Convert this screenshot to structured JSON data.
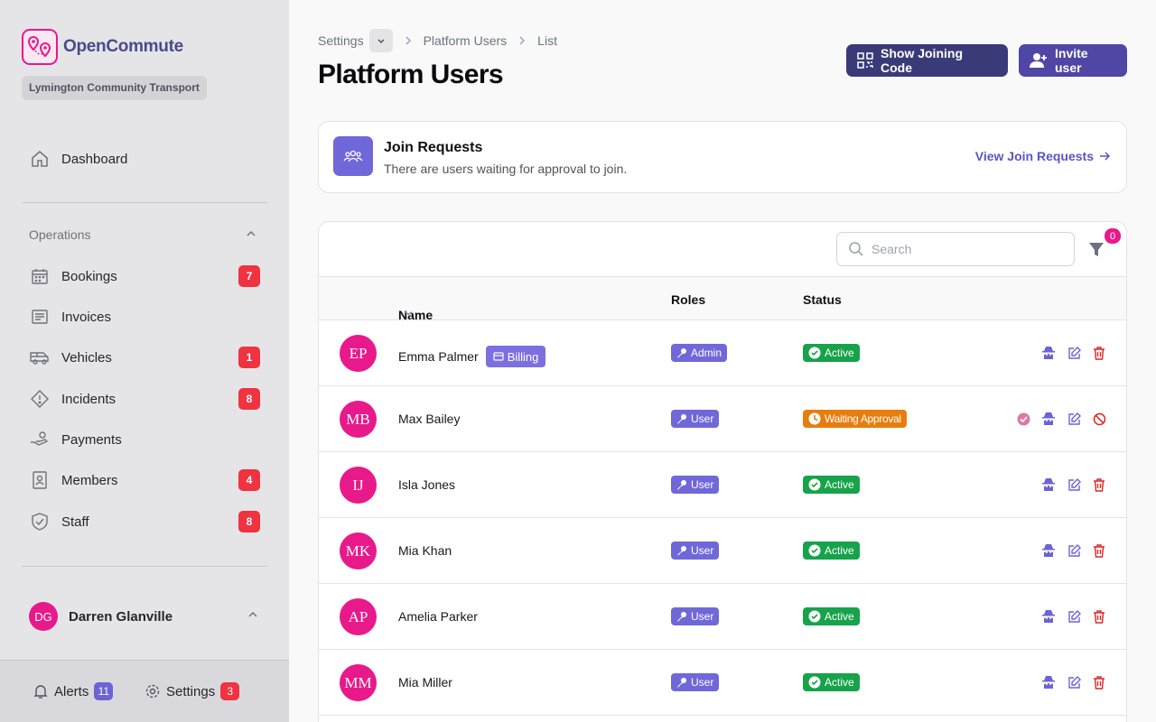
{
  "brand": {
    "name": "OpenCommute",
    "org": "Lymington Community Transport"
  },
  "nav": {
    "dashboard": "Dashboard",
    "section": "Operations",
    "items": [
      {
        "label": "Bookings",
        "count": "7"
      },
      {
        "label": "Invoices",
        "count": ""
      },
      {
        "label": "Vehicles",
        "count": "1"
      },
      {
        "label": "Incidents",
        "count": "8"
      },
      {
        "label": "Payments",
        "count": ""
      },
      {
        "label": "Members",
        "count": "4"
      },
      {
        "label": "Staff",
        "count": "8"
      }
    ]
  },
  "user": {
    "initials": "DG",
    "name": "Darren Glanville"
  },
  "footer": {
    "alerts_label": "Alerts",
    "alerts_count": "11",
    "settings_label": "Settings",
    "settings_count": "3"
  },
  "breadcrumb": {
    "root": "Settings",
    "section": "Platform Users",
    "current": "List"
  },
  "page": {
    "title": "Platform Users"
  },
  "actions": {
    "joining_code": "Show Joining Code",
    "invite": "Invite user"
  },
  "join_requests": {
    "title": "Join Requests",
    "subtitle": "There are users waiting for approval to join.",
    "link": "View Join Requests"
  },
  "search": {
    "placeholder": "Search"
  },
  "filter": {
    "count": "0"
  },
  "table": {
    "columns": {
      "name": "Name",
      "roles": "Roles",
      "status": "Status"
    },
    "rows": [
      {
        "initials": "EP",
        "name": "Emma Palmer",
        "tag": "Billing",
        "role": "Admin",
        "status": "Active"
      },
      {
        "initials": "MB",
        "name": "Max Bailey",
        "tag": "",
        "role": "User",
        "status": "Waiting Approval"
      },
      {
        "initials": "IJ",
        "name": "Isla Jones",
        "tag": "",
        "role": "User",
        "status": "Active"
      },
      {
        "initials": "MK",
        "name": "Mia Khan",
        "tag": "",
        "role": "User",
        "status": "Active"
      },
      {
        "initials": "AP",
        "name": "Amelia Parker",
        "tag": "",
        "role": "User",
        "status": "Active"
      },
      {
        "initials": "MM",
        "name": "Mia Miller",
        "tag": "",
        "role": "User",
        "status": "Active"
      }
    ]
  },
  "colors": {
    "brand_pink": "#e8198b",
    "primary": "#4f46a5",
    "active": "#16a34a",
    "waiting": "#e67e0e",
    "badge_red": "#ef3340"
  },
  "icons": {
    "nav": [
      "calendar-icon",
      "invoice-icon",
      "van-icon",
      "warning-icon",
      "payment-hand-icon",
      "member-card-icon",
      "shield-icon"
    ],
    "row_actions": [
      "approve-icon",
      "impersonate-icon",
      "edit-icon",
      "delete-icon",
      "block-icon"
    ]
  }
}
